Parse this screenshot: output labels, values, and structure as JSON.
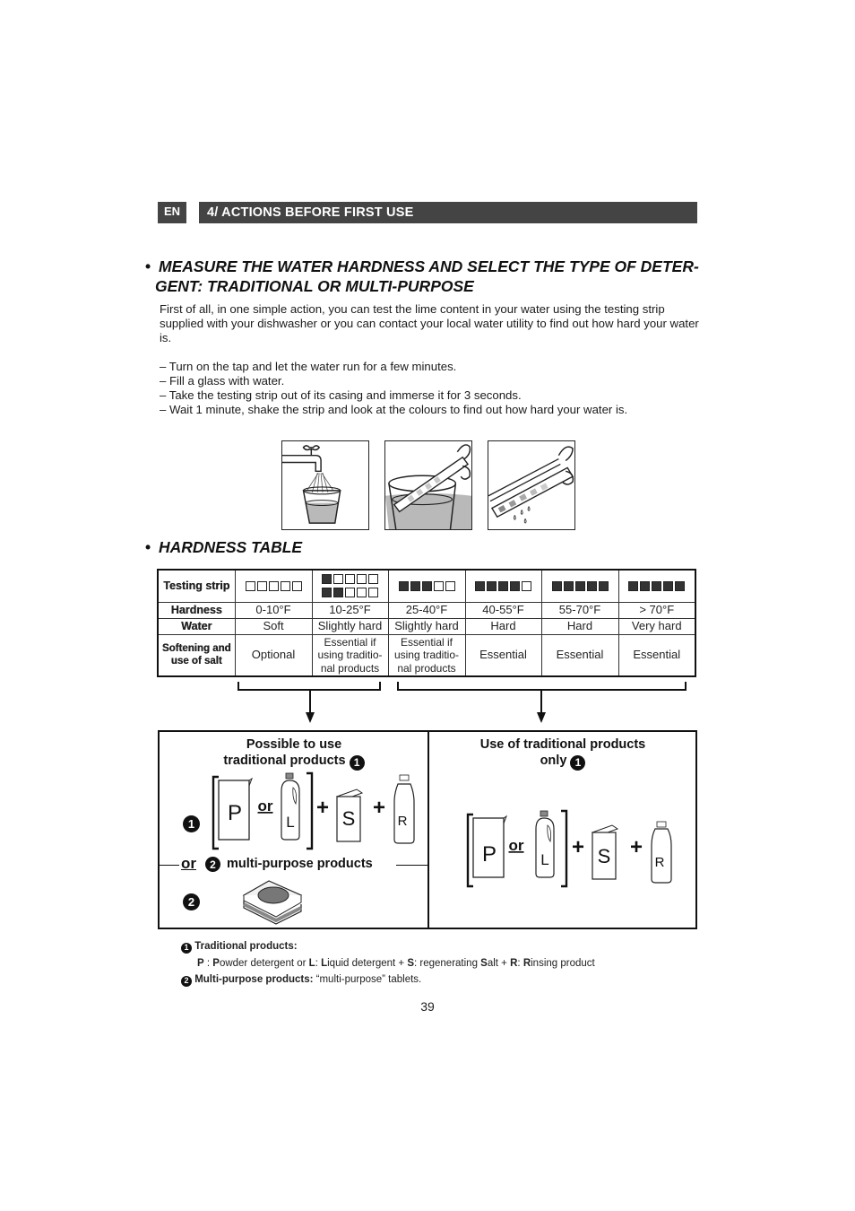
{
  "header": {
    "lang_badge": "EN",
    "section_title": "4/ ACTIONS BEFORE FIRST USE"
  },
  "measure": {
    "bullet": "•",
    "heading_line1": "MEASURE THE WATER HARDNESS AND SELECT THE TYPE OF DETER-",
    "heading_line2": "GENT: TRADITIONAL OR MULTI-PURPOSE",
    "intro": "First of all, in one simple action, you can test the lime content in your water using the testing strip supplied with your dishwasher or you can contact your local water utility to find out how hard your water is.",
    "steps": [
      "– Turn on the tap and let the water run for a few minutes.",
      "– Fill a glass with water.",
      "– Take the testing strip out of its casing and immerse it for 3 seconds.",
      "– Wait 1 minute, shake the strip and look at the colours to find out how hard your water is."
    ],
    "illustrations": [
      "tap-filling-glass",
      "strip-in-glass",
      "shaking-strip"
    ]
  },
  "hardness_table": {
    "bullet": "•",
    "heading": "HARDNESS TABLE",
    "row_headers": {
      "strip": "Testing strip",
      "hardness": "Hardness",
      "water": "Water",
      "salt_line1": "Softening and",
      "salt_line2": "use of salt"
    },
    "columns": [
      {
        "strips_filled": [
          0
        ],
        "hardness": "0-10°F",
        "water": "Soft",
        "salt": [
          "Optional"
        ]
      },
      {
        "strips_filled": [
          1,
          2
        ],
        "hardness": "10-25°F",
        "water": "Slightly hard",
        "salt": [
          "Essential if",
          "using traditio-",
          "nal products"
        ]
      },
      {
        "strips_filled": [
          3
        ],
        "hardness": "25-40°F",
        "water": "Slightly hard",
        "salt": [
          "Essential if",
          "using traditio-",
          "nal products"
        ]
      },
      {
        "strips_filled": [
          4
        ],
        "hardness": "40-55°F",
        "water": "Hard",
        "salt": [
          "Essential"
        ]
      },
      {
        "strips_filled": [
          5
        ],
        "hardness": "55-70°F",
        "water": "Hard",
        "salt": [
          "Essential"
        ]
      },
      {
        "strips_filled": [
          5
        ],
        "hardness": "> 70°F",
        "water": "Very hard",
        "salt": [
          "Essential"
        ]
      }
    ]
  },
  "options": {
    "left": {
      "title_line1": "Possible to use",
      "title_line2": "traditional products",
      "marker_1": "❶",
      "marker_2": "❷",
      "or_label": "or",
      "multi_label": "multi-purpose products",
      "products": {
        "p": "P",
        "l": "L",
        "s": "S",
        "r": "R",
        "plus": "+"
      }
    },
    "right": {
      "title_line1": "Use of traditional products",
      "title_line2": "only",
      "marker_1": "❶",
      "or_label": "or",
      "products": {
        "p": "P",
        "l": "L",
        "s": "S",
        "r": "R",
        "plus": "+"
      }
    }
  },
  "footnotes": {
    "n1_marker": "❶",
    "n1_title": "Traditional products:",
    "n1_parts": [
      "P",
      " : ",
      "P",
      "owder detergent or ",
      "L",
      ": ",
      "L",
      "iquid detergent + ",
      "S",
      ": regenerating ",
      "S",
      "alt + ",
      "R",
      ": ",
      "R",
      "insing product"
    ],
    "n2_marker": "❷",
    "n2_title": "Multi-purpose products:",
    "n2_text": " “multi-purpose” tablets."
  },
  "page_number": "39"
}
